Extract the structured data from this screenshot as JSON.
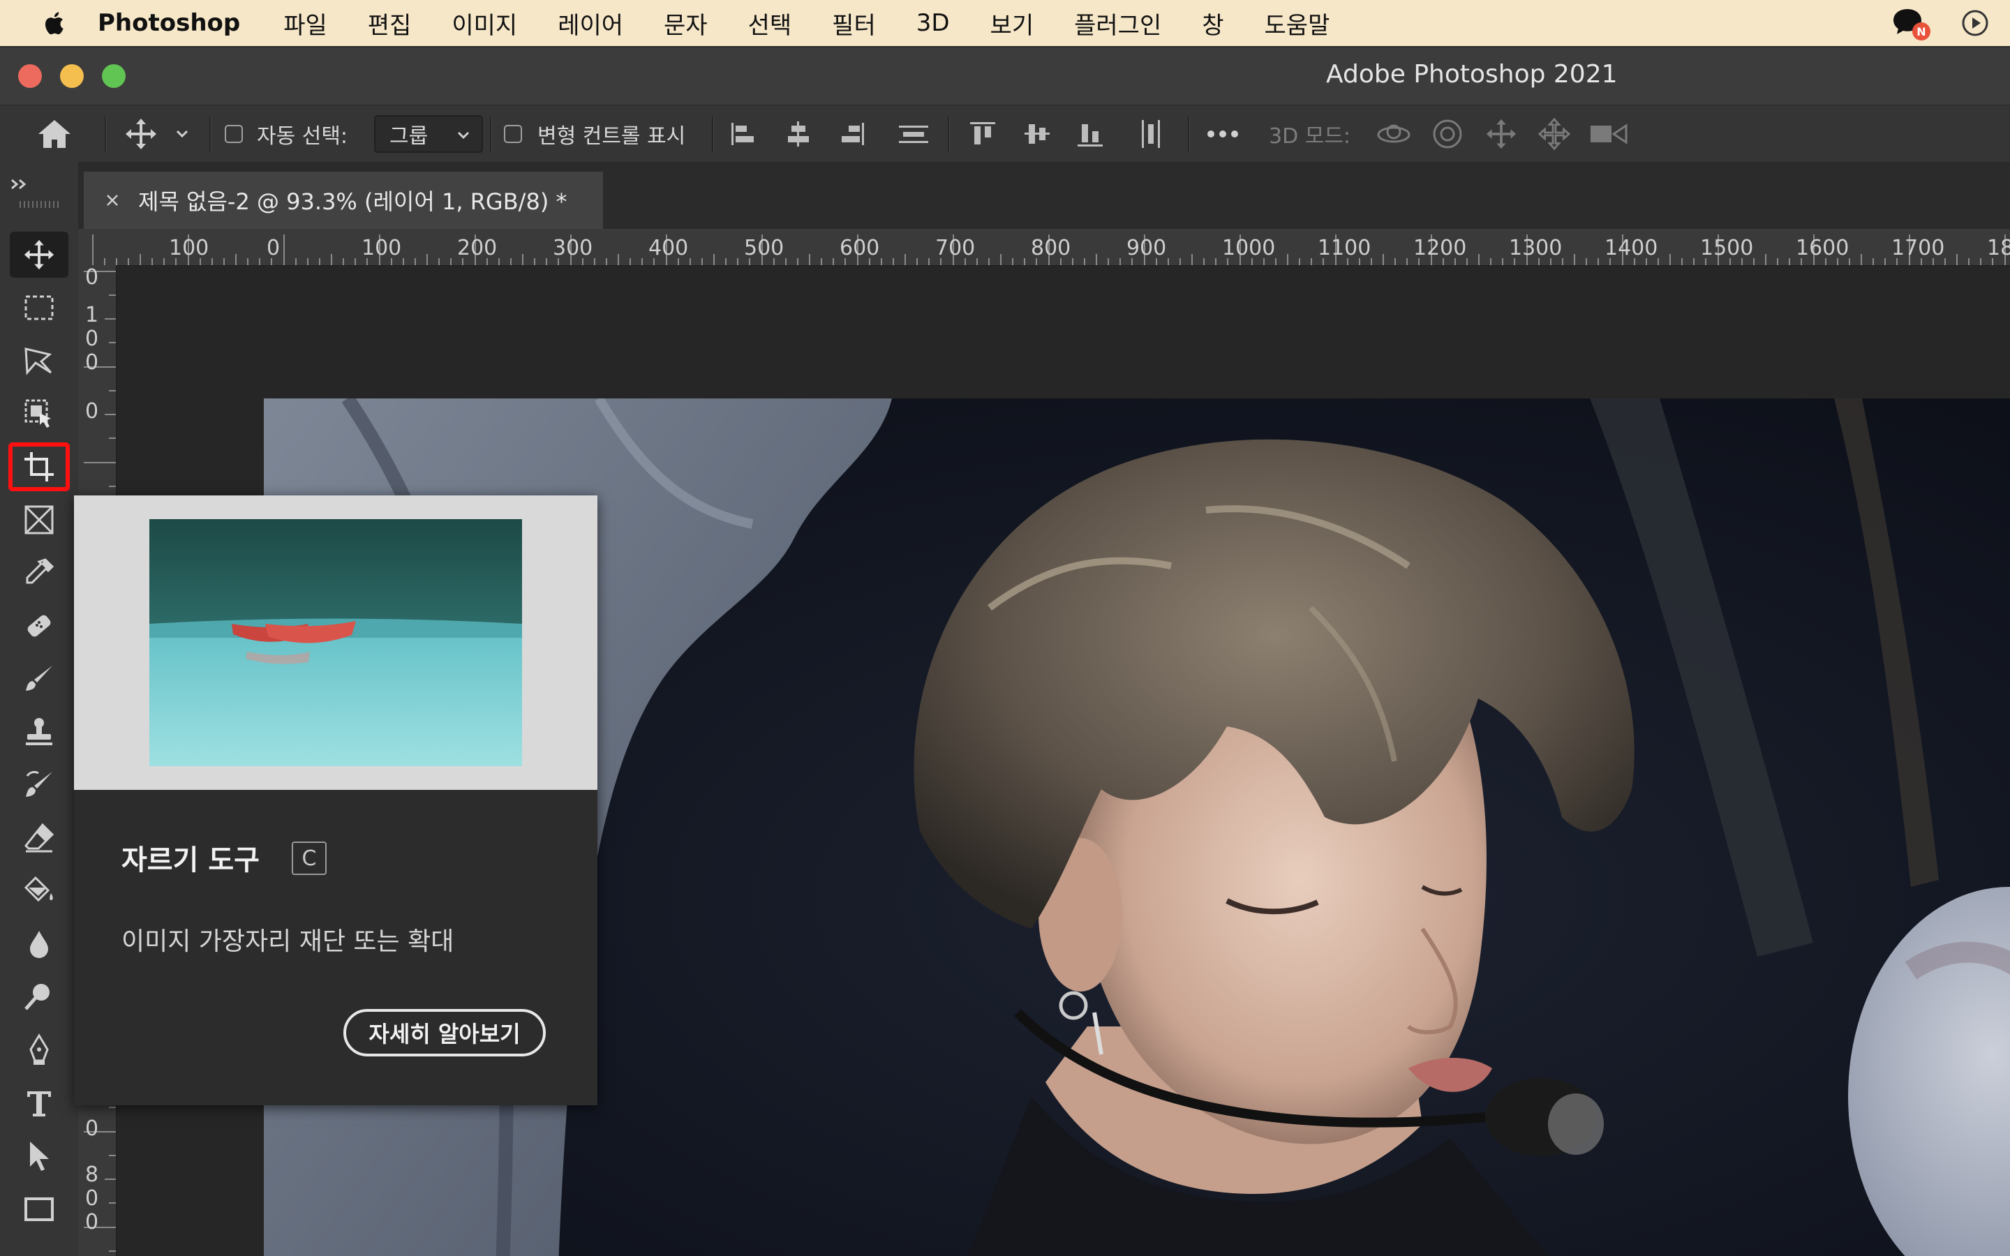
{
  "menubar": {
    "app_name": "Photoshop",
    "items": [
      "파일",
      "편집",
      "이미지",
      "레이어",
      "문자",
      "선택",
      "필터",
      "3D",
      "보기",
      "플러그인",
      "창",
      "도움말"
    ],
    "badge": "N"
  },
  "window": {
    "title": "Adobe Photoshop 2021"
  },
  "options": {
    "auto_select_label": "자동 선택:",
    "auto_select_value": "그룹",
    "transform_label": "변형 컨트롤 표시",
    "mode3d_label": "3D 모드:"
  },
  "document": {
    "tab_label": "제목 없음-2 @ 93.3% (레이어 1, RGB/8) *"
  },
  "rulers": {
    "horizontal": [
      "100",
      "0",
      "100",
      "200",
      "300",
      "400",
      "500",
      "600",
      "700",
      "800",
      "900",
      "1000",
      "1100",
      "1200",
      "1300",
      "1400",
      "1500",
      "1600",
      "1700",
      "18"
    ],
    "vertical_digits": [
      "0",
      "1",
      "0",
      "0",
      "0"
    ],
    "vertical_digits_bottom": [
      "0",
      "8",
      "0",
      "0"
    ]
  },
  "tools": [
    "move-tool",
    "marquee-tool",
    "lasso-tool",
    "object-selection-tool",
    "crop-tool",
    "frame-tool",
    "eyedropper-tool",
    "healing-brush-tool",
    "brush-tool",
    "clone-stamp-tool",
    "history-brush-tool",
    "eraser-tool",
    "paint-bucket-tool",
    "blur-tool",
    "dodge-tool",
    "pen-tool",
    "type-tool",
    "path-selection-tool",
    "rectangle-tool"
  ],
  "tooltip": {
    "title": "자르기 도구",
    "shortcut": "C",
    "description": "이미지 가장자리 재단 또는 확대",
    "learn_more": "자세히 알아보기"
  },
  "colors": {
    "menubar_bg": "#f6e7c8",
    "crop_highlight": "#ff1010",
    "panel_bg": "#353535"
  }
}
